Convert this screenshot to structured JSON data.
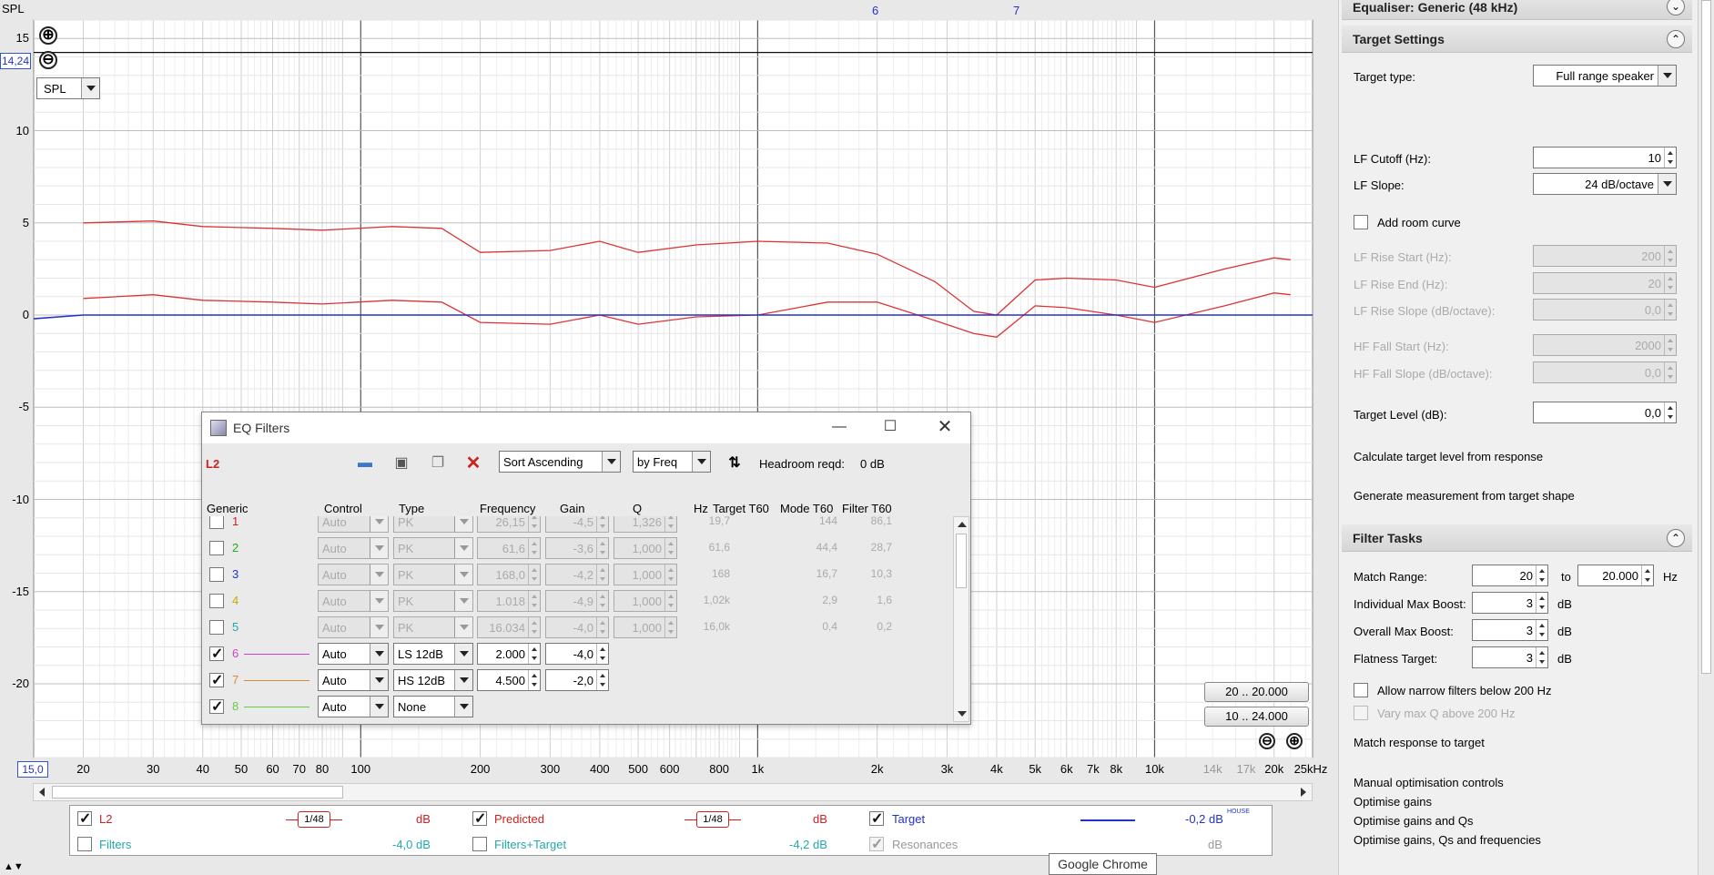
{
  "graph": {
    "y_axis_name": "SPL",
    "y_ticks": [
      "15",
      "10",
      "5",
      "0",
      "-5",
      "-10",
      "-15",
      "-20"
    ],
    "x_ticks": [
      "20",
      "30",
      "40",
      "50",
      "60",
      "70",
      "80",
      "100",
      "200",
      "300",
      "400",
      "500",
      "600",
      "800",
      "1k",
      "2k",
      "3k",
      "4k",
      "5k",
      "6k",
      "7k",
      "8k",
      "10k"
    ],
    "x_ticks_dim": [
      "14k",
      "17k",
      "20k"
    ],
    "x_unit_label": "25kHz",
    "cursor_value": "14,24",
    "bottom_value": "15,0",
    "top_markers": [
      "6",
      "7"
    ],
    "display_select": "SPL",
    "range_buttons": [
      "20 .. 20.000",
      "10 .. 24.000"
    ],
    "zoom_in_symbol": "⊕",
    "zoom_out_symbol": "⊖"
  },
  "chart_data": {
    "type": "line",
    "x_scale": "log",
    "xlim": [
      15,
      25000
    ],
    "ylim": [
      -24,
      16
    ],
    "series": [
      {
        "color": "#dd3333",
        "points": [
          [
            20,
            5.0
          ],
          [
            30,
            5.1
          ],
          [
            40,
            4.8
          ],
          [
            60,
            4.7
          ],
          [
            80,
            4.6
          ],
          [
            120,
            4.8
          ],
          [
            160,
            4.7
          ],
          [
            200,
            3.4
          ],
          [
            300,
            3.5
          ],
          [
            400,
            4.0
          ],
          [
            500,
            3.4
          ],
          [
            700,
            3.8
          ],
          [
            1000,
            4.0
          ],
          [
            1500,
            3.9
          ],
          [
            2000,
            3.3
          ],
          [
            2800,
            1.8
          ],
          [
            3500,
            0.2
          ],
          [
            4000,
            0.0
          ],
          [
            5000,
            1.9
          ],
          [
            6000,
            2.0
          ],
          [
            8000,
            1.9
          ],
          [
            10000,
            1.5
          ],
          [
            15000,
            2.5
          ],
          [
            20000,
            3.1
          ],
          [
            22000,
            3.0
          ]
        ]
      },
      {
        "color": "#dd3333",
        "points": [
          [
            20,
            0.9
          ],
          [
            30,
            1.1
          ],
          [
            40,
            0.8
          ],
          [
            60,
            0.7
          ],
          [
            80,
            0.6
          ],
          [
            120,
            0.8
          ],
          [
            160,
            0.7
          ],
          [
            200,
            -0.4
          ],
          [
            300,
            -0.5
          ],
          [
            400,
            0.0
          ],
          [
            500,
            -0.5
          ],
          [
            700,
            -0.1
          ],
          [
            1000,
            0.0
          ],
          [
            1500,
            0.7
          ],
          [
            2000,
            0.7
          ],
          [
            2800,
            -0.3
          ],
          [
            3500,
            -1.0
          ],
          [
            4000,
            -1.2
          ],
          [
            5000,
            0.5
          ],
          [
            6000,
            0.4
          ],
          [
            8000,
            0.0
          ],
          [
            10000,
            -0.4
          ],
          [
            15000,
            0.5
          ],
          [
            20000,
            1.2
          ],
          [
            22000,
            1.1
          ]
        ]
      },
      {
        "color": "#2233cc",
        "points": [
          [
            15,
            -0.2
          ],
          [
            20,
            0.0
          ],
          [
            25000,
            0.0
          ]
        ]
      }
    ]
  },
  "scrollbar": {
    "left_arrow": "◄",
    "right_arrow": "►"
  },
  "legend": {
    "items": [
      {
        "label": "L2",
        "color": "#cc2222",
        "value": "dB",
        "smoothing": "1/48",
        "checked": true
      },
      {
        "label": "Predicted",
        "color": "#cc2222",
        "value": "dB",
        "smoothing": "1/48",
        "checked": true
      },
      {
        "label": "Target",
        "color": "#2233cc",
        "value": "-0,2 dB",
        "value_sup": "HOUSE",
        "checked": true
      },
      {
        "label": "Filters",
        "color": "#22aaaa",
        "value": "-4,0 dB",
        "checked": false
      },
      {
        "label": "Filters+Target",
        "color": "#22aaaa",
        "value": "-4,2 dB",
        "checked": false
      },
      {
        "label": "Resonances",
        "color": "#999999",
        "value": "dB",
        "checked": true
      }
    ]
  },
  "tooltip": "Google Chrome",
  "eq": {
    "title": "EQ Filters",
    "channel": "L2",
    "sort_order": "Sort Ascending",
    "sort_by": "by Freq",
    "headroom_label": "Headroom reqd:",
    "headroom_value": "0 dB",
    "columns": {
      "generic": "Generic",
      "control": "Control",
      "type": "Type",
      "frequency": "Frequency",
      "gain": "Gain",
      "q": "Q",
      "hz": "Hz",
      "target_t60": "Target T60",
      "mode_t60": "Mode T60",
      "filter_t60": "Filter T60"
    },
    "rows": [
      {
        "num": "1",
        "color": "#cc2222",
        "checked": false,
        "enabled": false,
        "control": "Auto",
        "type": "PK",
        "freq": "26,15",
        "gain": "-4,5",
        "q": "1,326",
        "hz": "19,7",
        "mode": "144",
        "filter": "86,1"
      },
      {
        "num": "2",
        "color": "#22aa22",
        "checked": false,
        "enabled": false,
        "control": "Auto",
        "type": "PK",
        "freq": "61,6",
        "gain": "-3,6",
        "q": "1,000",
        "hz": "61,6",
        "mode": "44,4",
        "filter": "28,7"
      },
      {
        "num": "3",
        "color": "#2233cc",
        "checked": false,
        "enabled": false,
        "control": "Auto",
        "type": "PK",
        "freq": "168,0",
        "gain": "-4,2",
        "q": "1,000",
        "hz": "168",
        "mode": "16,7",
        "filter": "10,3"
      },
      {
        "num": "4",
        "color": "#ccaa00",
        "checked": false,
        "enabled": false,
        "control": "Auto",
        "type": "PK",
        "freq": "1.018",
        "gain": "-4,9",
        "q": "1,000",
        "hz": "1,02k",
        "mode": "2,9",
        "filter": "1,6"
      },
      {
        "num": "5",
        "color": "#22aaaa",
        "checked": false,
        "enabled": false,
        "control": "Auto",
        "type": "PK",
        "freq": "16.034",
        "gain": "-4,0",
        "q": "1,000",
        "hz": "16,0k",
        "mode": "0,4",
        "filter": "0,2"
      },
      {
        "num": "6",
        "color": "#cc44cc",
        "checked": true,
        "enabled": true,
        "control": "Auto",
        "type": "LS 12dB",
        "freq": "2.000",
        "gain": "-4,0"
      },
      {
        "num": "7",
        "color": "#dd8833",
        "checked": true,
        "enabled": true,
        "control": "Auto",
        "type": "HS 12dB",
        "freq": "4.500",
        "gain": "-2,0"
      },
      {
        "num": "8",
        "color": "#66cc44",
        "checked": true,
        "enabled": true,
        "control": "Auto",
        "type": "None"
      }
    ]
  },
  "panel": {
    "equaliser_header": "Equaliser: Generic (48 kHz)",
    "target_header": "Target Settings",
    "target_type_label": "Target type:",
    "target_type_value": "Full range speaker",
    "lf_cutoff_label": "LF Cutoff (Hz):",
    "lf_cutoff_value": "10",
    "lf_slope_label": "LF Slope:",
    "lf_slope_value": "24 dB/octave",
    "add_room_curve": "Add room curve",
    "lf_rise_start_label": "LF Rise Start (Hz):",
    "lf_rise_start_value": "200",
    "lf_rise_end_label": "LF Rise End (Hz):",
    "lf_rise_end_value": "20",
    "lf_rise_slope_label": "LF Rise Slope (dB/octave):",
    "lf_rise_slope_value": "0,0",
    "hf_fall_start_label": "HF Fall Start (Hz):",
    "hf_fall_start_value": "2000",
    "hf_fall_slope_label": "HF Fall Slope (dB/octave):",
    "hf_fall_slope_value": "0,0",
    "target_level_label": "Target Level (dB):",
    "target_level_value": "0,0",
    "calc_target": "Calculate target level from response",
    "gen_measurement": "Generate measurement from target shape",
    "filter_tasks_header": "Filter Tasks",
    "match_range_label": "Match Range:",
    "match_range_from": "20",
    "match_range_to_label": "to",
    "match_range_to": "20.000",
    "match_range_unit": "Hz",
    "indiv_boost_label": "Individual Max Boost:",
    "indiv_boost_value": "3",
    "overall_boost_label": "Overall Max Boost:",
    "overall_boost_value": "3",
    "flatness_label": "Flatness Target:",
    "flatness_value": "3",
    "db_unit": "dB",
    "allow_narrow": "Allow narrow filters below 200 Hz",
    "vary_q": "Vary max Q above 200 Hz",
    "match_response": "Match response to target",
    "manual_controls": "Manual optimisation controls",
    "opt_gains": "Optimise gains",
    "opt_gains_qs": "Optimise gains and Qs",
    "opt_gains_qs_freqs": "Optimise gains, Qs and frequencies"
  }
}
